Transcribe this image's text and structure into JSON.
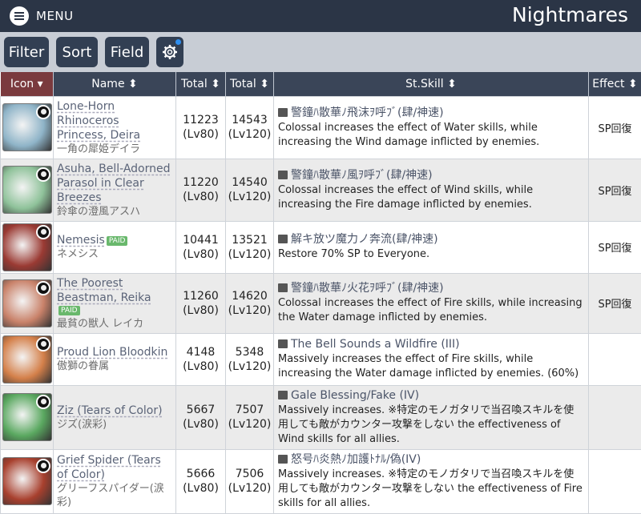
{
  "header": {
    "menu_label": "MENU",
    "title": "Nightmares"
  },
  "toolbar": {
    "filter": "Filter",
    "sort": "Sort",
    "field": "Field"
  },
  "table": {
    "headers": {
      "icon": "Icon",
      "name": "Name",
      "total1": "Total",
      "total2": "Total",
      "stskill": "St.Skill",
      "effect": "Effect"
    },
    "rows": [
      {
        "en": "Lone-Horn Rhinoceros Princess, Deira",
        "paid": "",
        "jp": "一角の犀姫デイラ",
        "t1": "11223",
        "t1lv": "(Lv80)",
        "t2": "14543",
        "t2lv": "(Lv120)",
        "skill_name": "警鐘ﾊ散華ﾉ飛沫ｦ呼ﾌﾞ(肆/神速)",
        "skill_desc": "Colossal increases the effect of Water skills, while increasing the Wind damage inflicted by enemies.",
        "effect": "SP回復",
        "color": "#8fb4c8"
      },
      {
        "en": "Asuha, Bell-Adorned Parasol in Clear Breezes",
        "paid": "",
        "jp": "鈴傘の澄風アスハ",
        "t1": "11220",
        "t1lv": "(Lv80)",
        "t2": "14540",
        "t2lv": "(Lv120)",
        "skill_name": "警鐘ﾊ散華ﾉ風ｦ呼ﾌﾞ(肆/神速)",
        "skill_desc": "Colossal increases the effect of Wind skills, while increasing the Fire damage inflicted by enemies.",
        "effect": "SP回復",
        "color": "#8fc29a"
      },
      {
        "en": "Nemesis",
        "paid": "PAID",
        "jp": "ネメシス",
        "t1": "10441",
        "t1lv": "(Lv80)",
        "t2": "13521",
        "t2lv": "(Lv120)",
        "skill_name": "解キ放ツ魔力ノ奔流(肆/神速)",
        "skill_desc": "Restore 70% SP to Everyone.",
        "effect": "SP回復",
        "color": "#9a3a33"
      },
      {
        "en": "The Poorest Beastman, Reika",
        "paid": "PAID",
        "jp": "最貧の獣人 レイカ",
        "t1": "11260",
        "t1lv": "(Lv80)",
        "t2": "14620",
        "t2lv": "(Lv120)",
        "skill_name": "警鐘ﾊ散華ﾉ火花ｦ呼ﾌﾞ(肆/神速)",
        "skill_desc": "Colossal increases the effect of Fire skills, while increasing the Water damage inflicted by enemies.",
        "effect": "SP回復",
        "color": "#c9826a"
      },
      {
        "en": "Proud Lion Bloodkin",
        "paid": "",
        "jp": "傲獅の眷属",
        "t1": "4148",
        "t1lv": "(Lv80)",
        "t2": "5348",
        "t2lv": "(Lv120)",
        "skill_name": "The Bell Sounds a Wildfire (III)",
        "skill_desc": "Massively increases the effect of Fire skills, while increasing the Water damage inflicted by enemies. (60%)",
        "effect": "",
        "color": "#d4804a"
      },
      {
        "en": "Ziz (Tears of Color)",
        "paid": "",
        "jp": "ジズ(涙彩)",
        "t1": "5667",
        "t1lv": "(Lv80)",
        "t2": "7507",
        "t2lv": "(Lv120)",
        "skill_name": "Gale Blessing/Fake (IV)",
        "skill_desc": "Massively increases. ※特定のモノガタリで当召喚スキルを使用しても敵がカウンター攻撃をしない the effectiveness of Wind skills for all allies.",
        "effect": "",
        "color": "#5aa860"
      },
      {
        "en": "Grief Spider (Tears of Color)",
        "paid": "",
        "jp": "グリーフスパイダー(涙彩)",
        "t1": "5666",
        "t1lv": "(Lv80)",
        "t2": "7506",
        "t2lv": "(Lv120)",
        "skill_name": "怒号ﾊ炎熱ﾉ加護ﾄﾅﾙ/偽(IV)",
        "skill_desc": "Massively increases. ※特定のモノガタリで当召喚スキルを使用しても敵がカウンター攻撃をしない the effectiveness of Fire skills for all allies.",
        "effect": "",
        "color": "#a8402e"
      }
    ]
  }
}
